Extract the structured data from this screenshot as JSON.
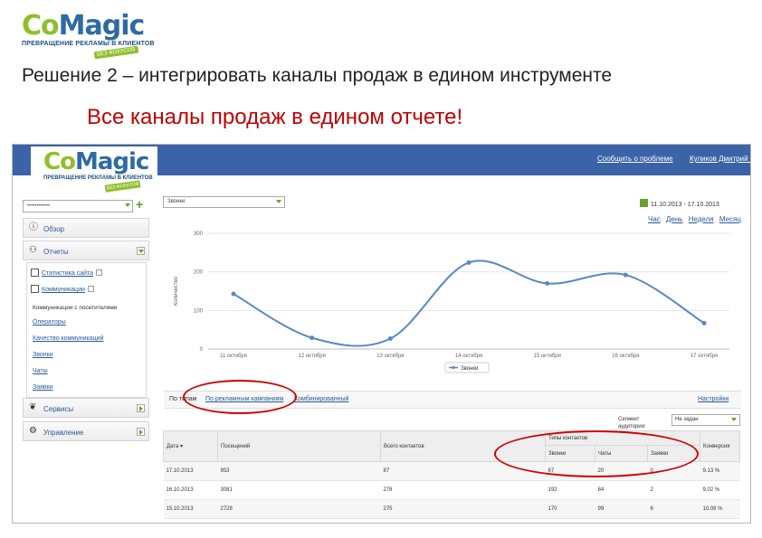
{
  "slide": {
    "logo": {
      "co": "Co",
      "magic": "Magic",
      "tagline": "ПРЕВРАЩЕНИЕ РЕКЛАМЫ В КЛИЕНТОВ",
      "badge": "БЕЗ ФОКУСОВ"
    },
    "title": "Решение 2 – интегрировать каналы продаж в едином инструменте",
    "subtitle": "Все  каналы продаж в едином отчете!"
  },
  "app": {
    "topbar": {
      "report_problem": "Сообщить о проблеме",
      "user": "Куликов Дмитрий ▾"
    },
    "logo": {
      "co": "Co",
      "magic": "Magic",
      "tagline": "ПРЕВРАЩЕНИЕ РЕКЛАМЫ В КЛИЕНТОВ",
      "badge": "БЕЗ ФОКУСОВ"
    },
    "site_select": {
      "value": "••••••••••••"
    },
    "nav": {
      "overview": "Обзор",
      "reports": "Отчеты",
      "services": "Сервисы",
      "management": "Управление"
    },
    "reports_sub": {
      "site_stats": "Статистика сайта",
      "communications": "Коммуникации",
      "heading": "Коммуникации с посетителями",
      "links": [
        "Операторы",
        "Качество коммуникаций",
        "Звонки",
        "Чаты",
        "Заявки"
      ]
    },
    "metric_select": "Звонки",
    "date_range": "11.10.2013 - 17.10.2013",
    "period": [
      "Час",
      "День",
      "Неделя",
      "Месяц"
    ],
    "report_tabs": {
      "prefix": "По типам",
      "campaigns": "По рекламным кампаниям",
      "combined": "Комбинированный",
      "settings": "Настройки"
    },
    "segment": {
      "label_line1": "Сегмент",
      "label_line2": "аудитории:",
      "value": "Не задан"
    },
    "table": {
      "headers": {
        "date": "Дата ▾",
        "visits": "Посещений",
        "total_contacts": "Всего контактов",
        "contact_types": "Типы контактов",
        "calls": "Звонки",
        "chats": "Чаты",
        "requests": "Заявки",
        "conversion": "Конверсия"
      },
      "rows": [
        {
          "date": "17.10.2013",
          "visits": "953",
          "total": "87",
          "calls": "67",
          "chats": "20",
          "requests": "0",
          "conversion": "9.13 %"
        },
        {
          "date": "16.10.2013",
          "visits": "3081",
          "total": "278",
          "calls": "192",
          "chats": "84",
          "requests": "2",
          "conversion": "9.02 %"
        },
        {
          "date": "15.10.2013",
          "visits": "2728",
          "total": "275",
          "calls": "170",
          "chats": "99",
          "requests": "6",
          "conversion": "10.08 %"
        }
      ]
    }
  },
  "chart_data": {
    "type": "line",
    "ylabel": "Количество",
    "ylim": [
      0,
      300
    ],
    "yticks": [
      0,
      100,
      200,
      300
    ],
    "categories": [
      "11 октября",
      "12 октября",
      "13 октября",
      "14 октября",
      "15 октября",
      "16 октября",
      "17 октября"
    ],
    "series": [
      {
        "name": "Звонки",
        "values": [
          143,
          29,
          27,
          224,
          170,
          192,
          67
        ]
      }
    ],
    "line_color": "#5b87c5",
    "grid": true,
    "legend": "bottom"
  }
}
